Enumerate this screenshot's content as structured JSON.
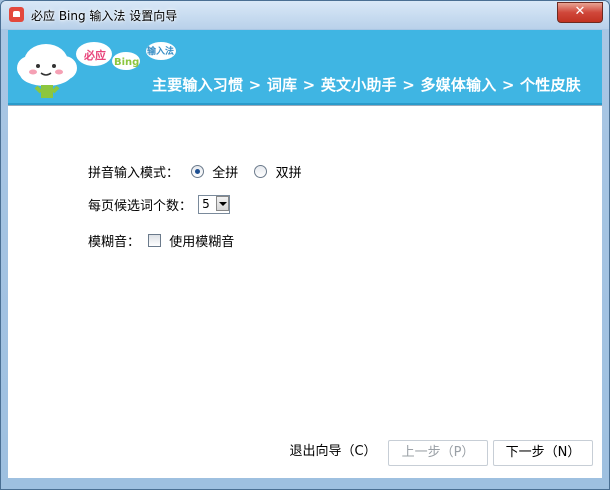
{
  "window": {
    "title": "必应 Bing 输入法 设置向导",
    "close_label": "✕"
  },
  "banner": {
    "logo_text_1": "必应",
    "logo_text_2": "Bing",
    "logo_text_3": "输入法",
    "steps": "主要输入习惯 > 词库 > 英文小助手 > 多媒体输入 > 个性皮肤",
    "accent_color": "#3fb5e3"
  },
  "form": {
    "pinyin_mode_label": "拼音输入模式：",
    "pinyin_option_full": "全拼",
    "pinyin_option_double": "双拼",
    "pinyin_selected": "全拼",
    "per_page_label": "每页候选词个数：",
    "per_page_value": "5",
    "fuzzy_label": "模糊音：",
    "fuzzy_checkbox_label": "使用模糊音",
    "fuzzy_checked": false
  },
  "footer": {
    "exit_label": "退出向导（C）",
    "prev_label": "上一步（P）",
    "next_label": "下一步（N）"
  }
}
